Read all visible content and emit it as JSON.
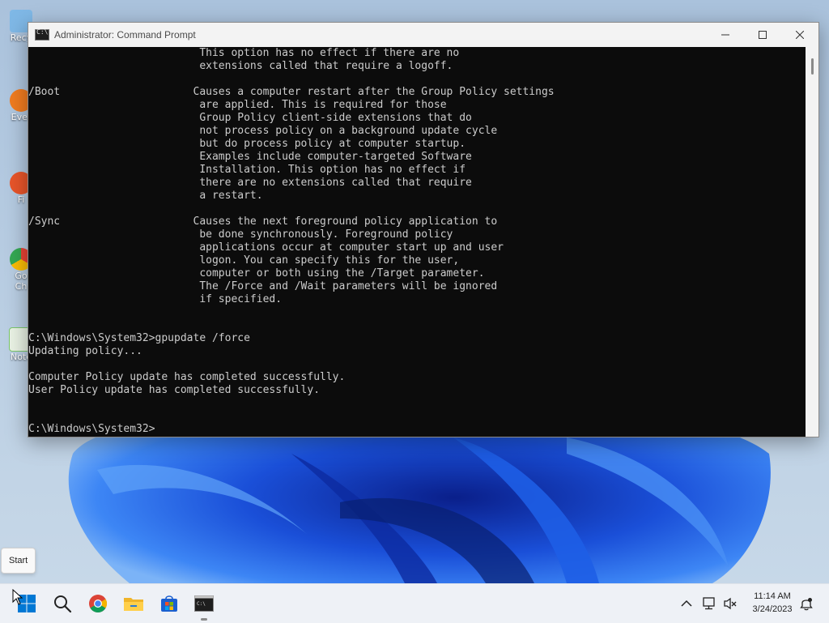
{
  "desktop": {
    "icons": [
      {
        "label": "Recy",
        "color": "#7fb8e6"
      },
      {
        "label": "Ever",
        "color": "#f07c20"
      },
      {
        "label": "Fi",
        "color": "#e8552a"
      },
      {
        "label": "Go\nCh",
        "color": "#4c8df6"
      },
      {
        "label": "Note",
        "color": "#7bc66b"
      }
    ]
  },
  "window": {
    "title": "Administrator: Command Prompt",
    "controls": {
      "minimize": "—",
      "maximize": "☐",
      "close": "✕"
    }
  },
  "console": {
    "lines": [
      "                           This option has no effect if there are no",
      "                           extensions called that require a logoff.",
      "",
      "/Boot                     Causes a computer restart after the Group Policy settings",
      "                           are applied. This is required for those",
      "                           Group Policy client-side extensions that do",
      "                           not process policy on a background update cycle",
      "                           but do process policy at computer startup.",
      "                           Examples include computer-targeted Software",
      "                           Installation. This option has no effect if",
      "                           there are no extensions called that require",
      "                           a restart.",
      "",
      "/Sync                     Causes the next foreground policy application to",
      "                           be done synchronously. Foreground policy",
      "                           applications occur at computer start up and user",
      "                           logon. You can specify this for the user,",
      "                           computer or both using the /Target parameter.",
      "                           The /Force and /Wait parameters will be ignored",
      "                           if specified.",
      "",
      "",
      "C:\\Windows\\System32>gpupdate /force",
      "Updating policy...",
      "",
      "Computer Policy update has completed successfully.",
      "User Policy update has completed successfully.",
      "",
      "",
      "C:\\Windows\\System32>"
    ]
  },
  "tooltip": {
    "text": "Start"
  },
  "taskbar": {
    "items": [
      "start-icon",
      "search-icon",
      "chrome-icon",
      "file-explorer-icon",
      "store-icon",
      "terminal-icon"
    ],
    "tray": [
      "chevron-up-icon",
      "network-icon",
      "volume-muted-icon",
      "notification-icon"
    ],
    "time": "11:14 AM",
    "date": "3/24/2023"
  },
  "colors": {
    "accent": "#0067c0",
    "console_bg": "#0c0c0c",
    "console_fg": "#cccccc"
  }
}
